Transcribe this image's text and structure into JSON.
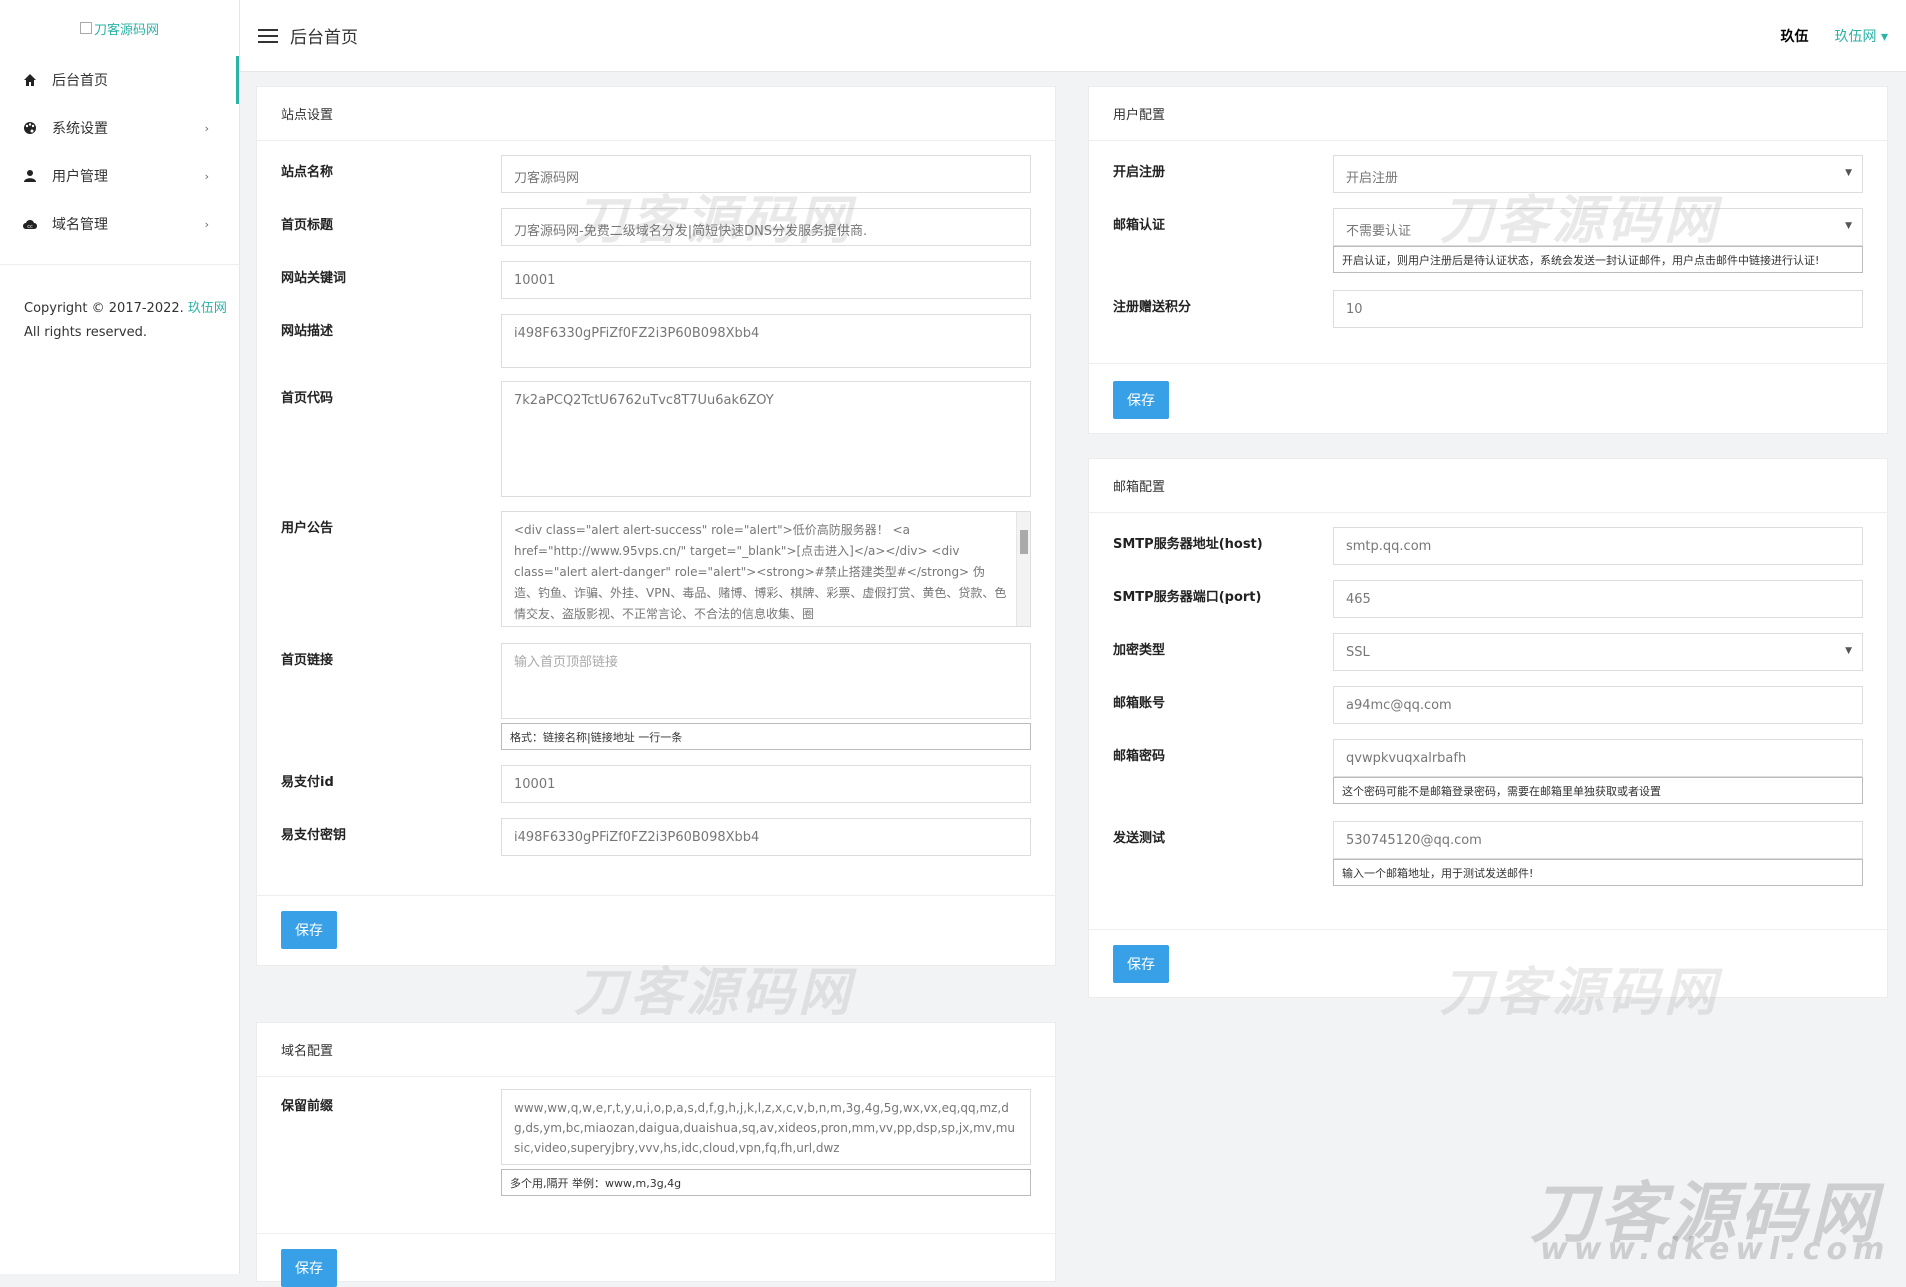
{
  "sidebar": {
    "logo_alt": "刀客源码网",
    "items": [
      {
        "label": "后台首页",
        "icon": "home-icon"
      },
      {
        "label": "系统设置",
        "icon": "palette-icon"
      },
      {
        "label": "用户管理",
        "icon": "user-icon"
      },
      {
        "label": "域名管理",
        "icon": "cloud-icon"
      }
    ],
    "copyright": "Copyright © 2017-2022.",
    "copyright_link": "玖伍网",
    "rights": "All rights reserved."
  },
  "header": {
    "title": "后台首页",
    "user": "玖伍",
    "site": "玖伍网 ▾"
  },
  "site_settings": {
    "title": "站点设置",
    "fields": [
      {
        "label": "站点名称",
        "value": "刀客源码网"
      },
      {
        "label": "首页标题",
        "value": "刀客源码网-免费二级域名分发|简短快速DNS分发服务提供商."
      },
      {
        "label": "网站关键词",
        "value": "10001"
      },
      {
        "label": "网站描述",
        "value": "i498F6330gPFiZf0FZ2i3P60B098Xbb4"
      },
      {
        "label": "首页代码",
        "value": "7k2aPCQ2TctU6762uTvc8T7Uu6ak6ZOY"
      },
      {
        "label": "用户公告",
        "value": "<div class=\"alert alert-success\" role=\"alert\">低价高防服务器！ <a href=\"http://www.95vps.cn/\" target=\"_blank\">[点击进入]</a></div>\n                    <div class=\"alert alert-danger\" role=\"alert\"><strong>#禁止搭建类型#</strong> 伪造、钓鱼、诈骗、外挂、VPN、毒品、赌博、博彩、棋牌、彩票、虚假打赏、黄色、贷款、色情交友、盗版影视、不正常言论、不合法的信息收集、圈"
      },
      {
        "label": "首页链接",
        "placeholder": "输入首页顶部链接",
        "hint": "格式：链接名称|链接地址 一行一条"
      },
      {
        "label": "易支付id",
        "value": "10001"
      },
      {
        "label": "易支付密钥",
        "value": "i498F6330gPFiZf0FZ2i3P60B098Xbb4"
      }
    ],
    "save": "保存"
  },
  "domain_config": {
    "title": "域名配置",
    "label": "保留前缀",
    "value": "www,ww,q,w,e,r,t,y,u,i,o,p,a,s,d,f,g,h,j,k,l,z,x,c,v,b,n,m,3g,4g,5g,wx,vx,eq,qq,mz,dg,ds,ym,bc,miaozan,daigua,duaishua,sq,av,xideos,pron,mm,vv,pp,dsp,sp,jx,mv,music,video,superyjbry,vvv,hs,idc,cloud,vpn,fq,fh,url,dwz",
    "hint": "多个用,隔开 举例：www,m,3g,4g",
    "save": "保存"
  },
  "user_config": {
    "title": "用户配置",
    "register_label": "开启注册",
    "register_value": "开启注册",
    "email_verify_label": "邮箱认证",
    "email_verify_value": "不需要认证",
    "email_verify_hint": "开启认证，则用户注册后是待认证状态，系统会发送一封认证邮件，用户点击邮件中链接进行认证!",
    "points_label": "注册赠送积分",
    "points_value": "10",
    "save": "保存"
  },
  "mail_config": {
    "title": "邮箱配置",
    "host_label": "SMTP服务器地址(host)",
    "host_value": "smtp.qq.com",
    "port_label": "SMTP服务器端口(port)",
    "port_value": "465",
    "enc_label": "加密类型",
    "enc_value": "SSL",
    "account_label": "邮箱账号",
    "account_value": "a94mc@qq.com",
    "password_label": "邮箱密码",
    "password_value": "qvwpkvuqxalrbafh",
    "password_hint": "这个密码可能不是邮箱登录密码，需要在邮箱里单独获取或者设置",
    "test_label": "发送测试",
    "test_value": "530745120@qq.com",
    "test_hint": "输入一个邮箱地址，用于测试发送邮件!",
    "save": "保存"
  },
  "watermark": {
    "text": "刀客源码网",
    "url": "www.dkewl.com"
  }
}
